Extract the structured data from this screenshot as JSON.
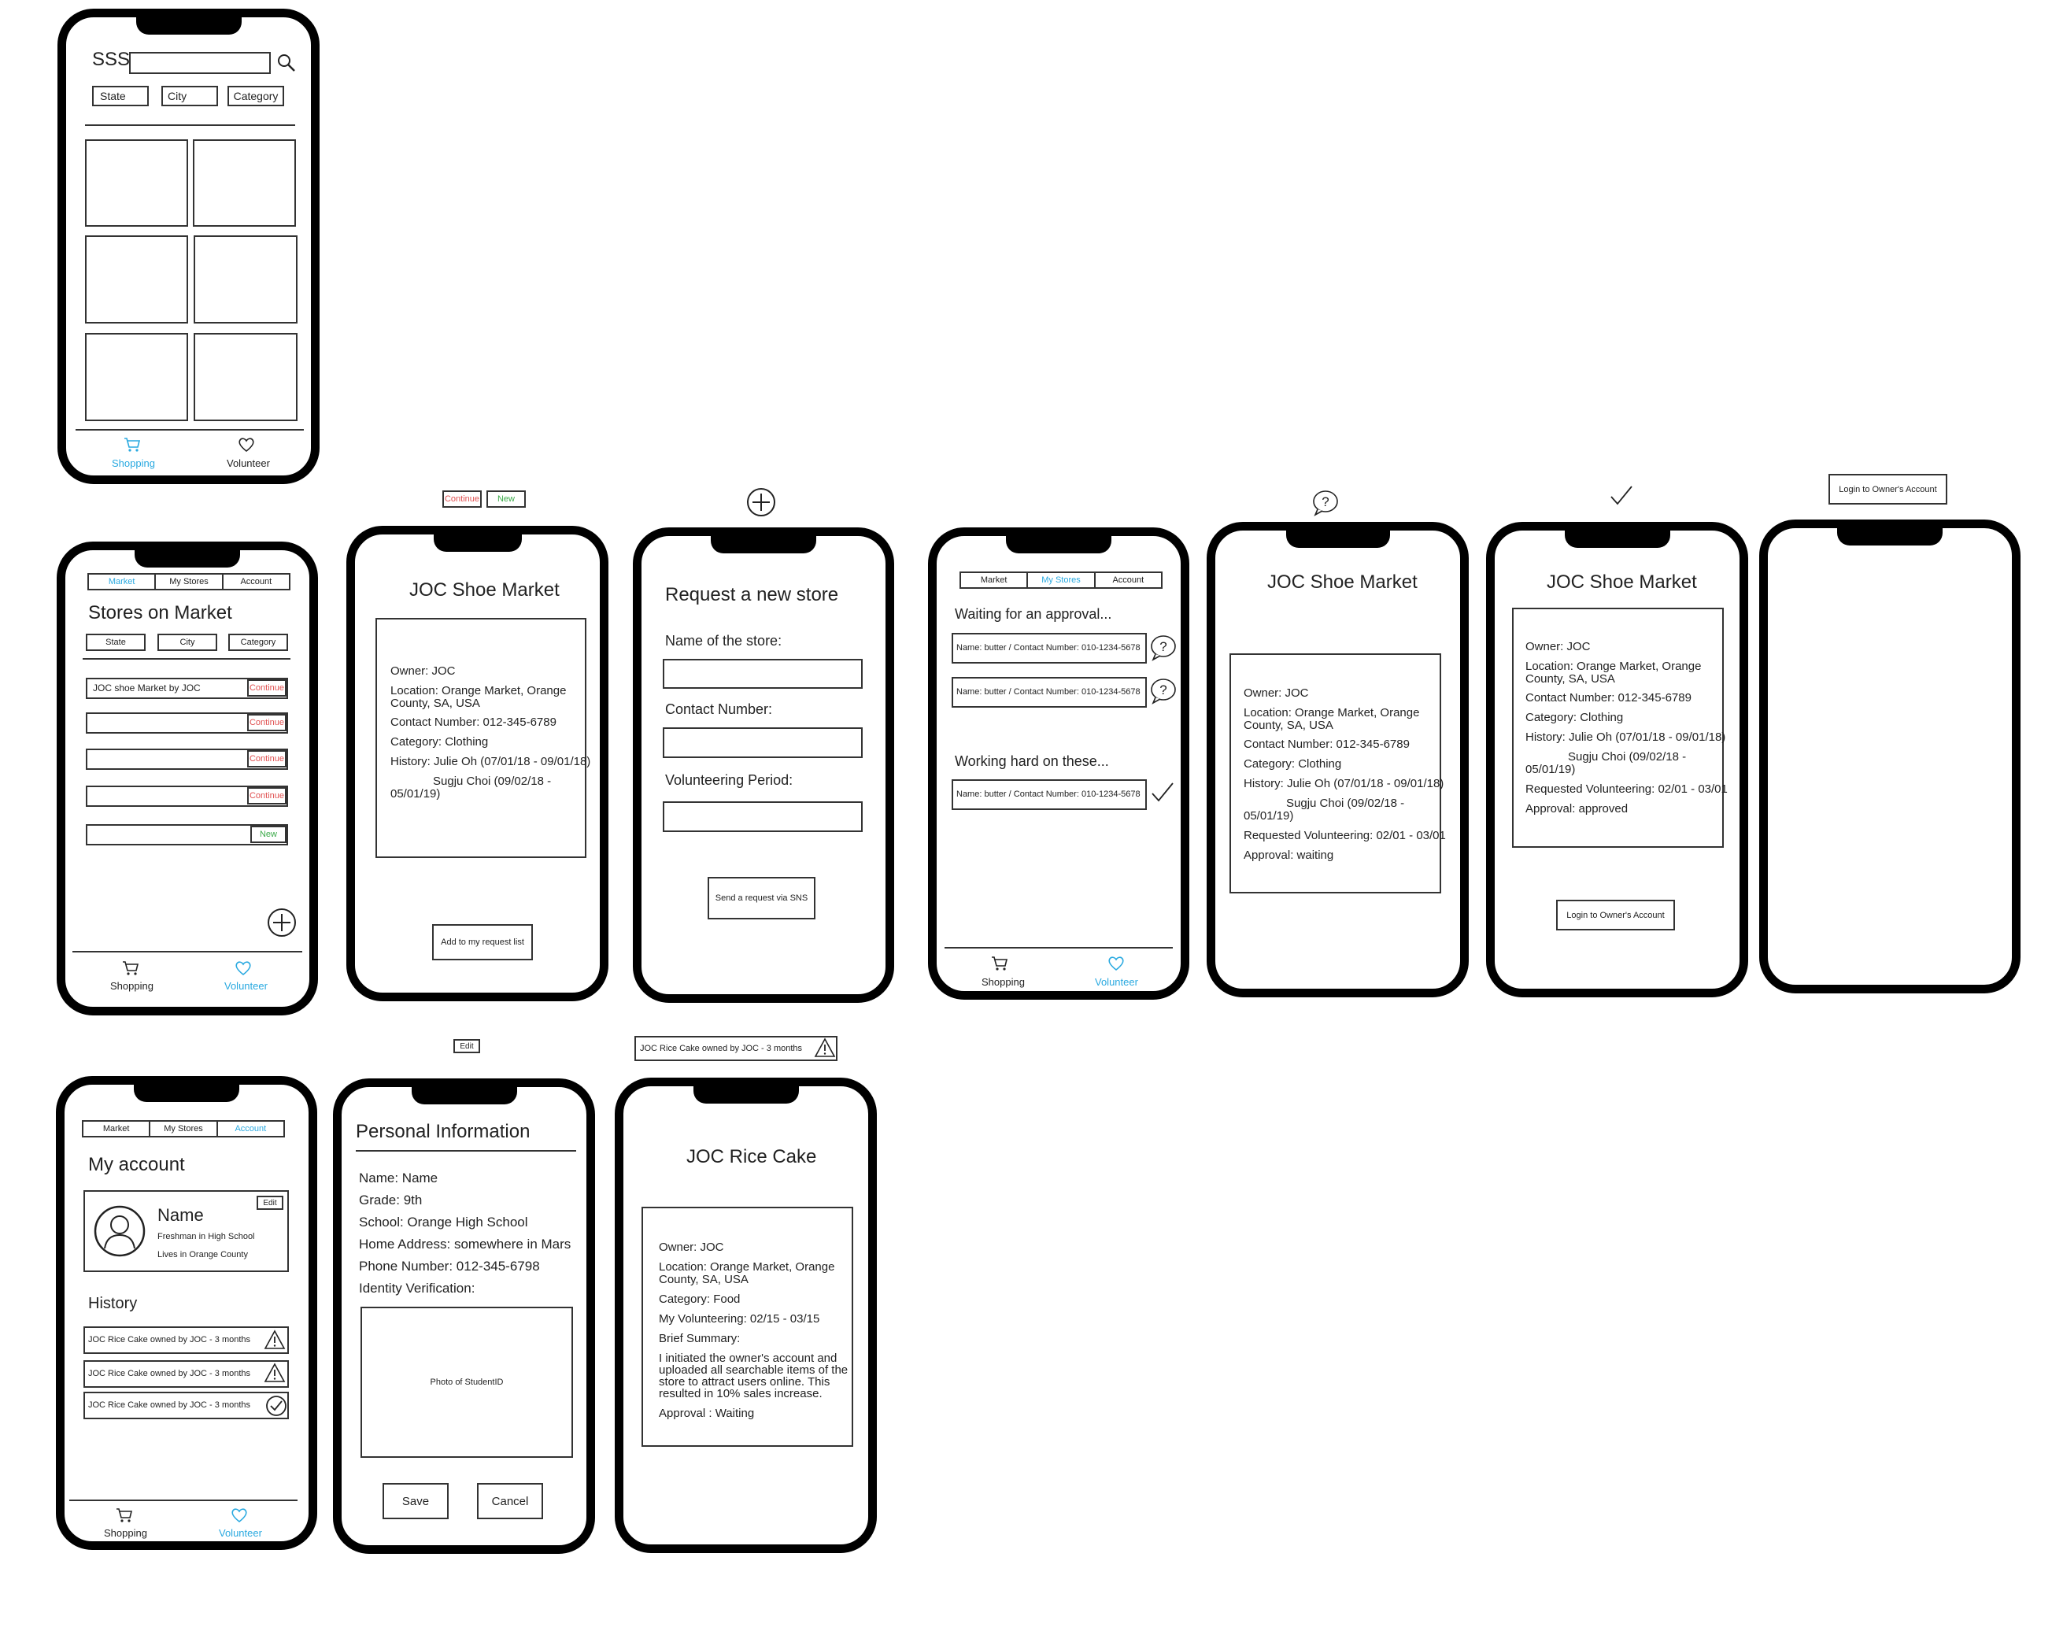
{
  "colors": {
    "accent": "#29a9e0",
    "continue": "#e05050",
    "new": "#3aaa48",
    "stroke": "#222222"
  },
  "screen1": {
    "app_title": "SSS",
    "filters": [
      "State",
      "City",
      "Category"
    ],
    "nav": {
      "shopping": "Shopping",
      "volunteer": "Volunteer"
    }
  },
  "screen2": {
    "tabs": [
      "Market",
      "My Stores",
      "Account"
    ],
    "title": "Stores on Market",
    "filters": [
      "State",
      "City",
      "Category"
    ],
    "rows": [
      {
        "label": "JOC shoe Market by JOC",
        "action": "Continue"
      },
      {
        "label": "",
        "action": "Continue"
      },
      {
        "label": "",
        "action": "Continue"
      },
      {
        "label": "",
        "action": "Continue"
      },
      {
        "label": "",
        "action": "New"
      }
    ],
    "nav": {
      "shopping": "Shopping",
      "volunteer": "Volunteer"
    }
  },
  "screen3": {
    "badge_continue": "Continue",
    "badge_new": "New",
    "title": "JOC Shoe Market",
    "lines": [
      "Owner: JOC",
      "Location: Orange Market, Orange",
      "County, SA, USA",
      "Contact Number: 012-345-6789",
      "Category: Clothing",
      "History: Julie Oh (07/01/18 - 09/01/18)",
      "Sugju Choi (09/02/18 -",
      "05/01/19)"
    ],
    "button": "Add to my request list"
  },
  "screen4": {
    "title": "Request a new store",
    "label_name": "Name of the store:",
    "label_contact": "Contact Number:",
    "label_period": "Volunteering Period:",
    "button": "Send a request via SNS"
  },
  "screen5": {
    "tabs": [
      "Market",
      "My Stores",
      "Account"
    ],
    "waiting": "Waiting for an approval...",
    "working": "Working hard on these...",
    "row": "Name: butter / Contact Number: 010-1234-5678",
    "nav": {
      "shopping": "Shopping",
      "volunteer": "Volunteer"
    }
  },
  "screen6": {
    "title": "JOC Shoe Market",
    "lines": [
      "Owner: JOC",
      "Location: Orange Market, Orange",
      "County, SA, USA",
      "Contact Number: 012-345-6789",
      "Category: Clothing",
      "History: Julie Oh (07/01/18 - 09/01/18)",
      "Sugju Choi (09/02/18 -",
      "05/01/19)",
      "Requested Volunteering: 02/01 - 03/01",
      "Approval: waiting"
    ]
  },
  "screen7": {
    "title": "JOC Shoe Market",
    "lines": [
      "Owner: JOC",
      "Location: Orange Market, Orange",
      "County, SA, USA",
      "Contact Number: 012-345-6789",
      "Category: Clothing",
      "History: Julie Oh (07/01/18 - 09/01/18)",
      "Sugju Choi (09/02/18 -",
      "05/01/19)",
      "Requested Volunteering: 02/01 - 03/01",
      "Approval: approved"
    ],
    "button": "Login to Owner's Account"
  },
  "screen8": {
    "above_button": "Login to Owner's Account"
  },
  "screen9": {
    "tabs": [
      "Market",
      "My Stores",
      "Account"
    ],
    "title": "My account",
    "edit": "Edit",
    "name": "Name",
    "sub1": "Freshman in High School",
    "sub2": "Lives in Orange County",
    "history_title": "History",
    "history": [
      "JOC Rice Cake owned by JOC - 3 months",
      "JOC Rice Cake owned by JOC - 3 months",
      "JOC Rice Cake owned by JOC - 3 months"
    ],
    "nav": {
      "shopping": "Shopping",
      "volunteer": "Volunteer"
    }
  },
  "screen10": {
    "edit_badge": "Edit",
    "title": "Personal Information",
    "lines": [
      "Name: Name",
      "Grade: 9th",
      "School: Orange High School",
      "Home Address: somewhere in Mars",
      "Phone Number: 012-345-6798",
      "Identity Verification:"
    ],
    "photo": "Photo of StudentID",
    "save": "Save",
    "cancel": "Cancel"
  },
  "screen11": {
    "header_item": "JOC Rice Cake owned by JOC - 3 months",
    "title": "JOC Rice Cake",
    "lines": [
      "Owner: JOC",
      "Location: Orange Market, Orange",
      "County, SA, USA",
      "Category: Food",
      "My Volunteering: 02/15 - 03/15",
      "Brief Summary:",
      "I initiated the owner's account and",
      "uploaded all searchable items of the",
      "store to attract users online. This",
      "resulted in 10% sales increase.",
      "Approval : Waiting"
    ]
  }
}
